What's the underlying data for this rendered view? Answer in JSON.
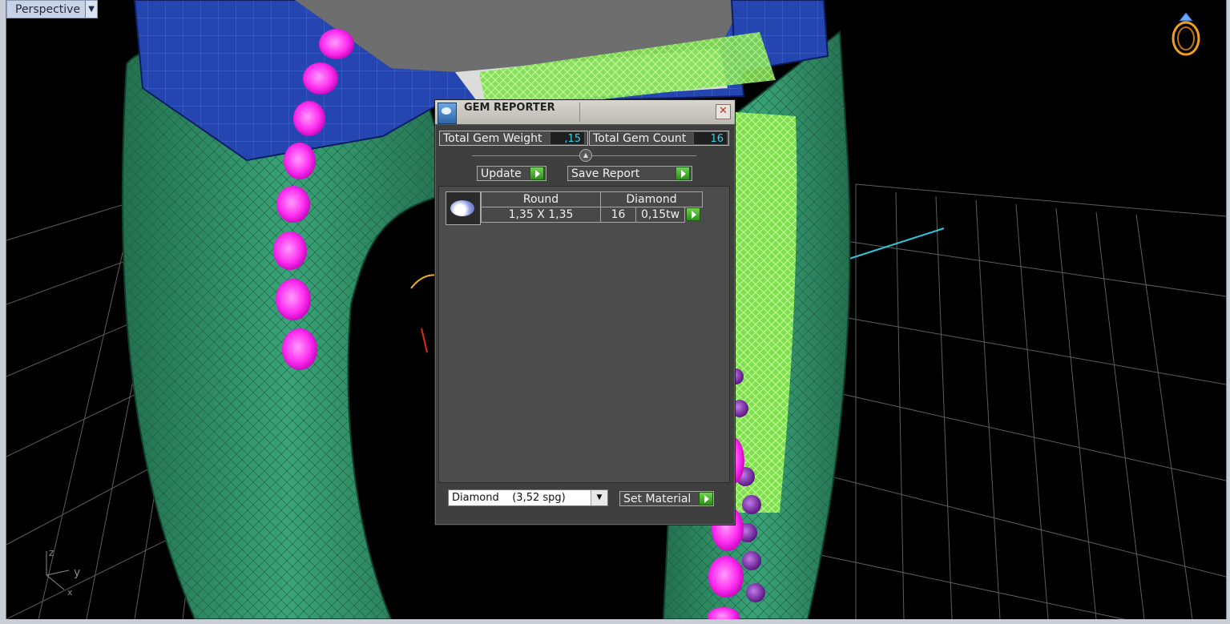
{
  "viewport": {
    "tab_label": "Perspective",
    "axis_labels": [
      "z",
      "y",
      "x"
    ]
  },
  "gem_reporter": {
    "title": "GEM REPORTER",
    "total_gem_weight_label": "Total Gem Weight",
    "total_gem_weight_value": ",15",
    "total_gem_count_label": "Total Gem Count",
    "total_gem_count_value": "16",
    "update_label": "Update",
    "save_report_label": "Save Report",
    "gems": [
      {
        "shape": "Round",
        "material": "Diamond",
        "size": "1,35 X 1,35",
        "count": "16",
        "weight": "0,15tw"
      }
    ],
    "material_select_value": "Diamond    (3,52 spg)",
    "set_material_label": "Set Material"
  },
  "colors": {
    "viewport_bg": "#000000",
    "grid": "#6a6a6a",
    "ring_body": "#2f8a63",
    "setting_blue": "#1f3fa0",
    "prongs_green": "#a7f07a",
    "gems_magenta": "#ff1cf0",
    "gems_purple": "#8a2fb8",
    "value_text": "#39d0e8"
  }
}
